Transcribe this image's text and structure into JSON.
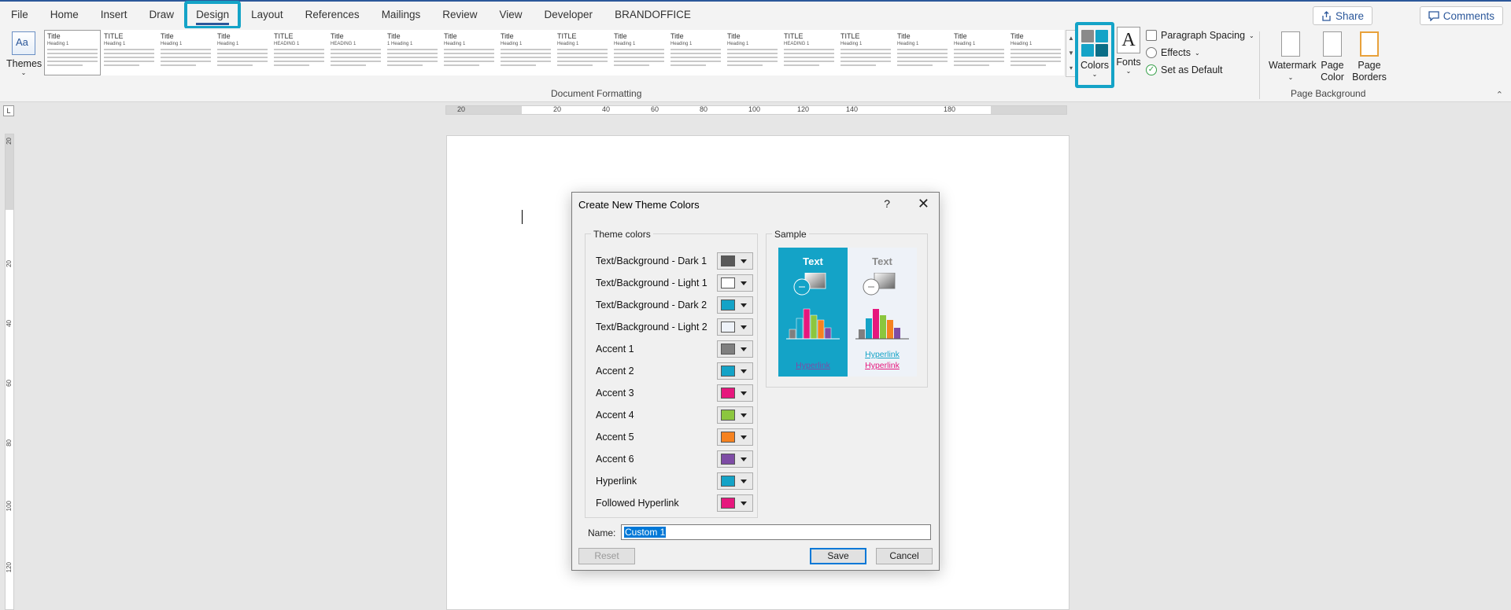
{
  "menu": {
    "tabs": [
      "File",
      "Home",
      "Insert",
      "Draw",
      "Design",
      "Layout",
      "References",
      "Mailings",
      "Review",
      "View",
      "Developer",
      "BRANDOFFICE"
    ],
    "active": "Design",
    "share_label": "Share",
    "comments_label": "Comments"
  },
  "ribbon": {
    "themes_label": "Themes",
    "document_formatting_label": "Document Formatting",
    "style_thumbs": [
      {
        "title": "Title",
        "heading": "Heading 1"
      },
      {
        "title": "TITLE",
        "heading": "Heading 1"
      },
      {
        "title": "Title",
        "heading": "Heading 1"
      },
      {
        "title": "Title",
        "heading": "Heading 1"
      },
      {
        "title": "TITLE",
        "heading": "HEADING 1"
      },
      {
        "title": "Title",
        "heading": "HEADING 1"
      },
      {
        "title": "Title",
        "heading": "1 Heading 1"
      },
      {
        "title": "Title",
        "heading": "Heading 1"
      },
      {
        "title": "Title",
        "heading": "Heading 1"
      },
      {
        "title": "TITLE",
        "heading": "Heading 1"
      },
      {
        "title": "Title",
        "heading": "Heading 1"
      },
      {
        "title": "Title",
        "heading": "Heading 1"
      },
      {
        "title": "Title",
        "heading": "Heading 1"
      },
      {
        "title": "TITLE",
        "heading": "HEADING 1"
      },
      {
        "title": "TITLE",
        "heading": "Heading 1"
      },
      {
        "title": "Title",
        "heading": "Heading 1"
      },
      {
        "title": "Title",
        "heading": "Heading 1"
      },
      {
        "title": "Title",
        "heading": "Heading 1"
      }
    ],
    "colors_label": "Colors",
    "fonts_label": "Fonts",
    "paragraph_spacing_label": "Paragraph Spacing",
    "effects_label": "Effects",
    "set_default_label": "Set as Default",
    "watermark_label": "Watermark",
    "page_color_label": "Page Color",
    "page_borders_label": "Page Borders",
    "page_background_label": "Page Background"
  },
  "ruler": {
    "h_numbers": [
      "20",
      "20",
      "40",
      "60",
      "80",
      "100",
      "120",
      "140",
      "180"
    ],
    "v_numbers": [
      "20",
      "20",
      "40",
      "60",
      "80",
      "100",
      "120"
    ]
  },
  "dialog": {
    "title": "Create New Theme Colors",
    "help": "?",
    "theme_colors_label": "Theme colors",
    "sample_label": "Sample",
    "rows": [
      {
        "label": "Text/Background - Dark 1",
        "color": "#595959"
      },
      {
        "label": "Text/Background - Light 1",
        "color": "#ffffff"
      },
      {
        "label": "Text/Background - Dark 2",
        "color": "#14a3c7"
      },
      {
        "label": "Text/Background - Light 2",
        "color": "#eef2f8"
      },
      {
        "label": "Accent 1",
        "color": "#7f7f7f"
      },
      {
        "label": "Accent 2",
        "color": "#14a3c7"
      },
      {
        "label": "Accent 3",
        "color": "#e6177d"
      },
      {
        "label": "Accent 4",
        "color": "#8cc63e"
      },
      {
        "label": "Accent 5",
        "color": "#f58220"
      },
      {
        "label": "Accent 6",
        "color": "#7e4ca5"
      },
      {
        "label": "Hyperlink",
        "color": "#14a3c7"
      },
      {
        "label": "Followed Hyperlink",
        "color": "#e6177d"
      }
    ],
    "sample": {
      "dark_text": "Text",
      "light_text": "Text",
      "dark_link": "Hyperlink",
      "light_link": "Hyperlink",
      "light_followed": "Hyperlink",
      "dark_bg": "#14a3c7",
      "light_bg": "#eef2f8"
    },
    "name_label": "Name:",
    "name_value": "Custom 1",
    "reset_label": "Reset",
    "save_label": "Save",
    "cancel_label": "Cancel"
  }
}
